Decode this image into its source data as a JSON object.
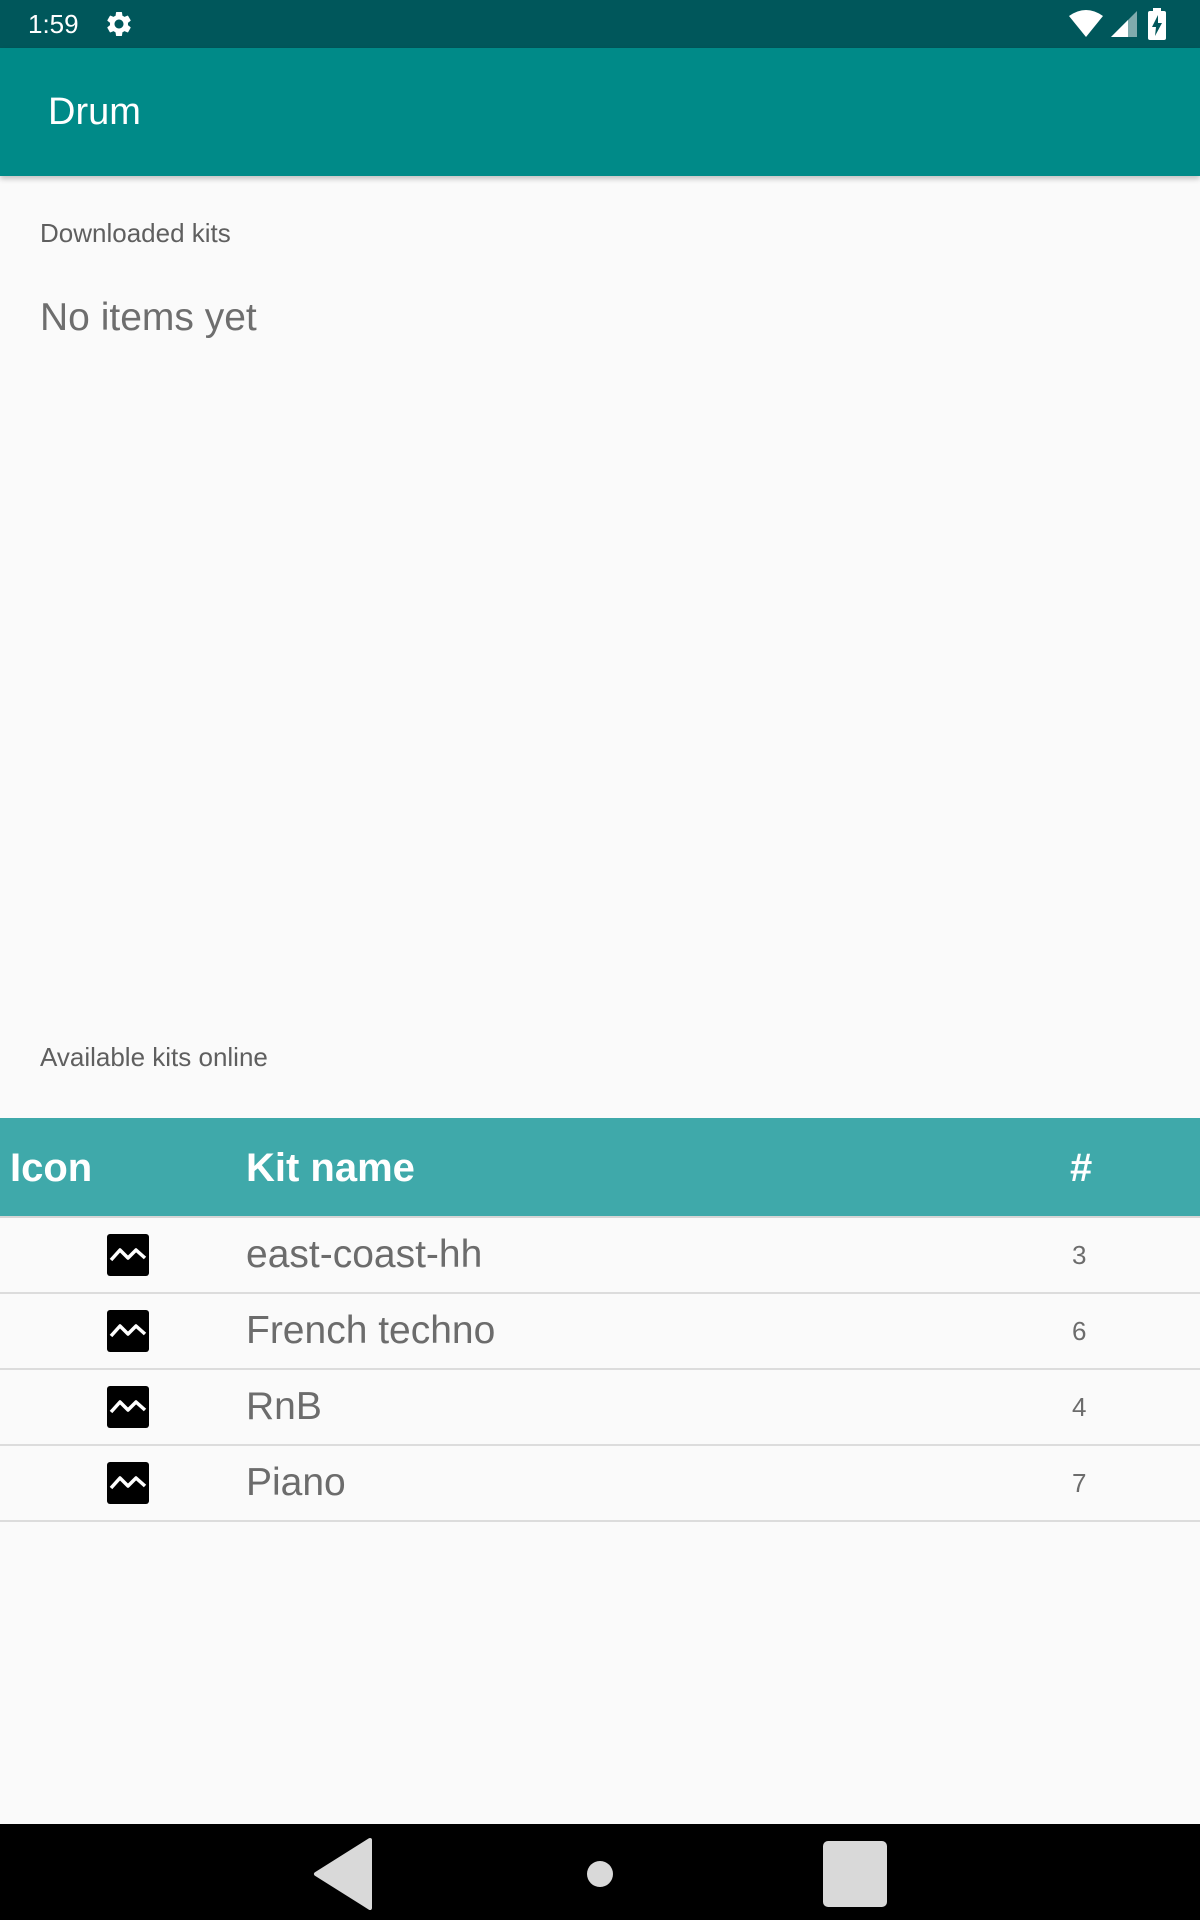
{
  "status_bar": {
    "time": "1:59",
    "icons": [
      "gear-icon",
      "wifi-icon",
      "signal-icon",
      "battery-charging-icon"
    ],
    "background_color": "#00575b"
  },
  "app_bar": {
    "title": "Drum",
    "background_color": "#008a88"
  },
  "downloaded": {
    "label": "Downloaded kits",
    "empty_text": "No items yet"
  },
  "available": {
    "label": "Available kits online",
    "table": {
      "header_color": "#3fa9aa",
      "columns": [
        "Icon",
        "Kit name",
        "#"
      ],
      "rows": [
        {
          "icon": "broken-image-icon",
          "name": "east-coast-hh",
          "count": "3"
        },
        {
          "icon": "broken-image-icon",
          "name": "French techno",
          "count": "6"
        },
        {
          "icon": "broken-image-icon",
          "name": "RnB",
          "count": "4"
        },
        {
          "icon": "broken-image-icon",
          "name": "Piano",
          "count": "7"
        }
      ]
    }
  },
  "nav_bar": {
    "buttons": [
      "back-icon",
      "home-icon",
      "recent-apps-icon"
    ]
  }
}
